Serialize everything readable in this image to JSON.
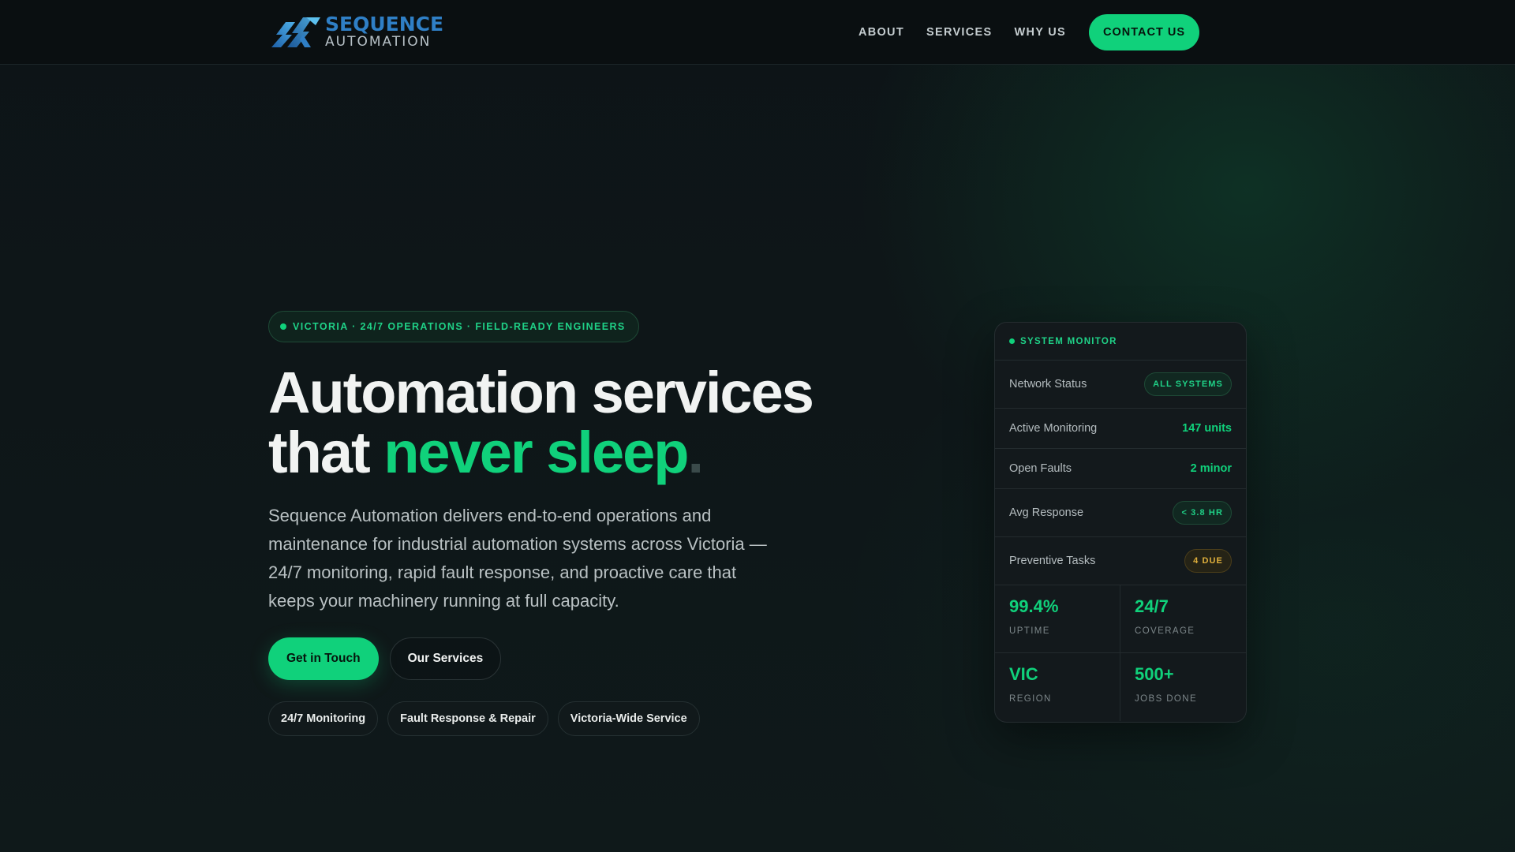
{
  "colors": {
    "accent": "#10d17b",
    "nav_bg": "#0a0f11",
    "card_bg": "#13191c",
    "amber": "#e0b03c",
    "logo_blue": "#2f7fc6"
  },
  "nav": {
    "logo": {
      "top": "SEQUENCE",
      "bottom": "AUTOMATION"
    },
    "links": [
      "ABOUT",
      "SERVICES",
      "WHY US"
    ],
    "cta": "CONTACT US"
  },
  "hero": {
    "badge": "VICTORIA · 24/7 OPERATIONS · FIELD-READY ENGINEERS",
    "headline_line1": "Automation services",
    "headline_line2_prefix": "that ",
    "headline_accent": "never sleep",
    "headline_period": ".",
    "lede": "Sequence Automation delivers end-to-end operations and maintenance for industrial automation systems across Victoria — 24/7 monitoring, rapid fault response, and proactive care that keeps your machinery running at full capacity.",
    "primary_button": "Get in Touch",
    "secondary_button": "Our Services",
    "chips": [
      "24/7 Monitoring",
      "Fault Response & Repair",
      "Victoria-Wide Service"
    ]
  },
  "monitor": {
    "title": "SYSTEM MONITOR",
    "rows": [
      {
        "label": "Network Status",
        "value": "ALL SYSTEMS",
        "style": "pill-green"
      },
      {
        "label": "Active Monitoring",
        "value": "147 units",
        "style": "text"
      },
      {
        "label": "Open Faults",
        "value": "2 minor",
        "style": "text"
      },
      {
        "label": "Avg Response",
        "value": "< 3.8 HR",
        "style": "pill-green"
      },
      {
        "label": "Preventive Tasks",
        "value": "4 DUE",
        "style": "pill-amber"
      }
    ],
    "stats": [
      {
        "value": "99.4%",
        "label": "UPTIME"
      },
      {
        "value": "24/7",
        "label": "COVERAGE"
      },
      {
        "value": "VIC",
        "label": "REGION"
      },
      {
        "value": "500+",
        "label": "JOBS DONE"
      }
    ]
  }
}
